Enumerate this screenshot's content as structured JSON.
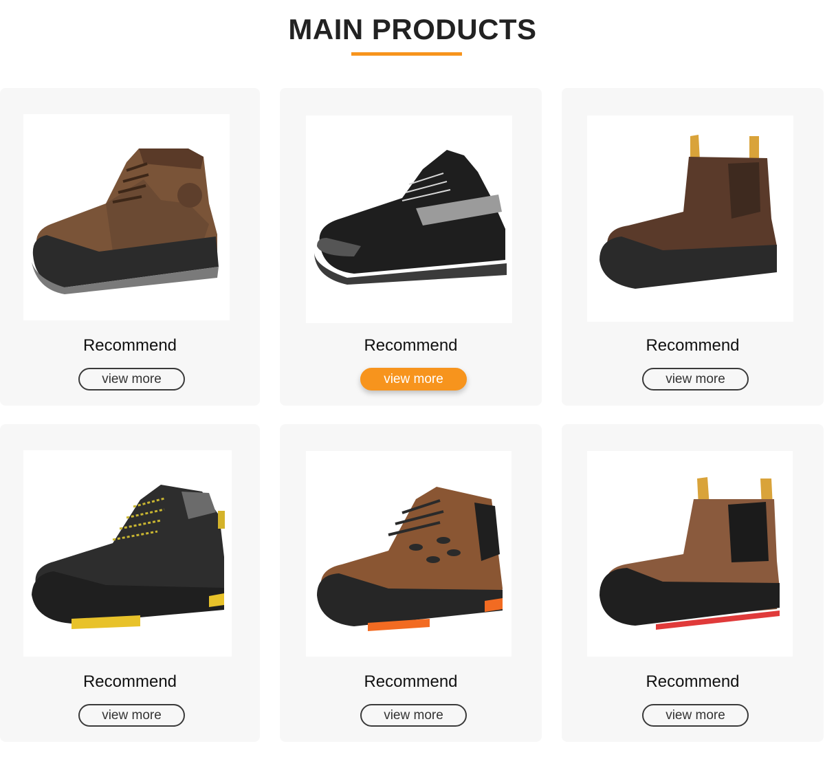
{
  "section": {
    "title": "MAIN PRODUCTS",
    "accent_color": "#f7941d"
  },
  "products": [
    {
      "label": "Recommend",
      "button_label": "view more",
      "image": "brown-leather-lace-up-safety-boot",
      "active": false
    },
    {
      "label": "Recommend",
      "button_label": "view more",
      "image": "black-low-cut-safety-shoe",
      "active": true
    },
    {
      "label": "Recommend",
      "button_label": "view more",
      "image": "brown-chelsea-safety-boot",
      "active": false
    },
    {
      "label": "Recommend",
      "button_label": "view more",
      "image": "black-hiker-boot-yellow-sole",
      "active": false
    },
    {
      "label": "Recommend",
      "button_label": "view more",
      "image": "brown-hiker-boot-orange-sole",
      "active": false
    },
    {
      "label": "Recommend",
      "button_label": "view more",
      "image": "brown-chelsea-boot-red-sole",
      "active": false
    }
  ]
}
